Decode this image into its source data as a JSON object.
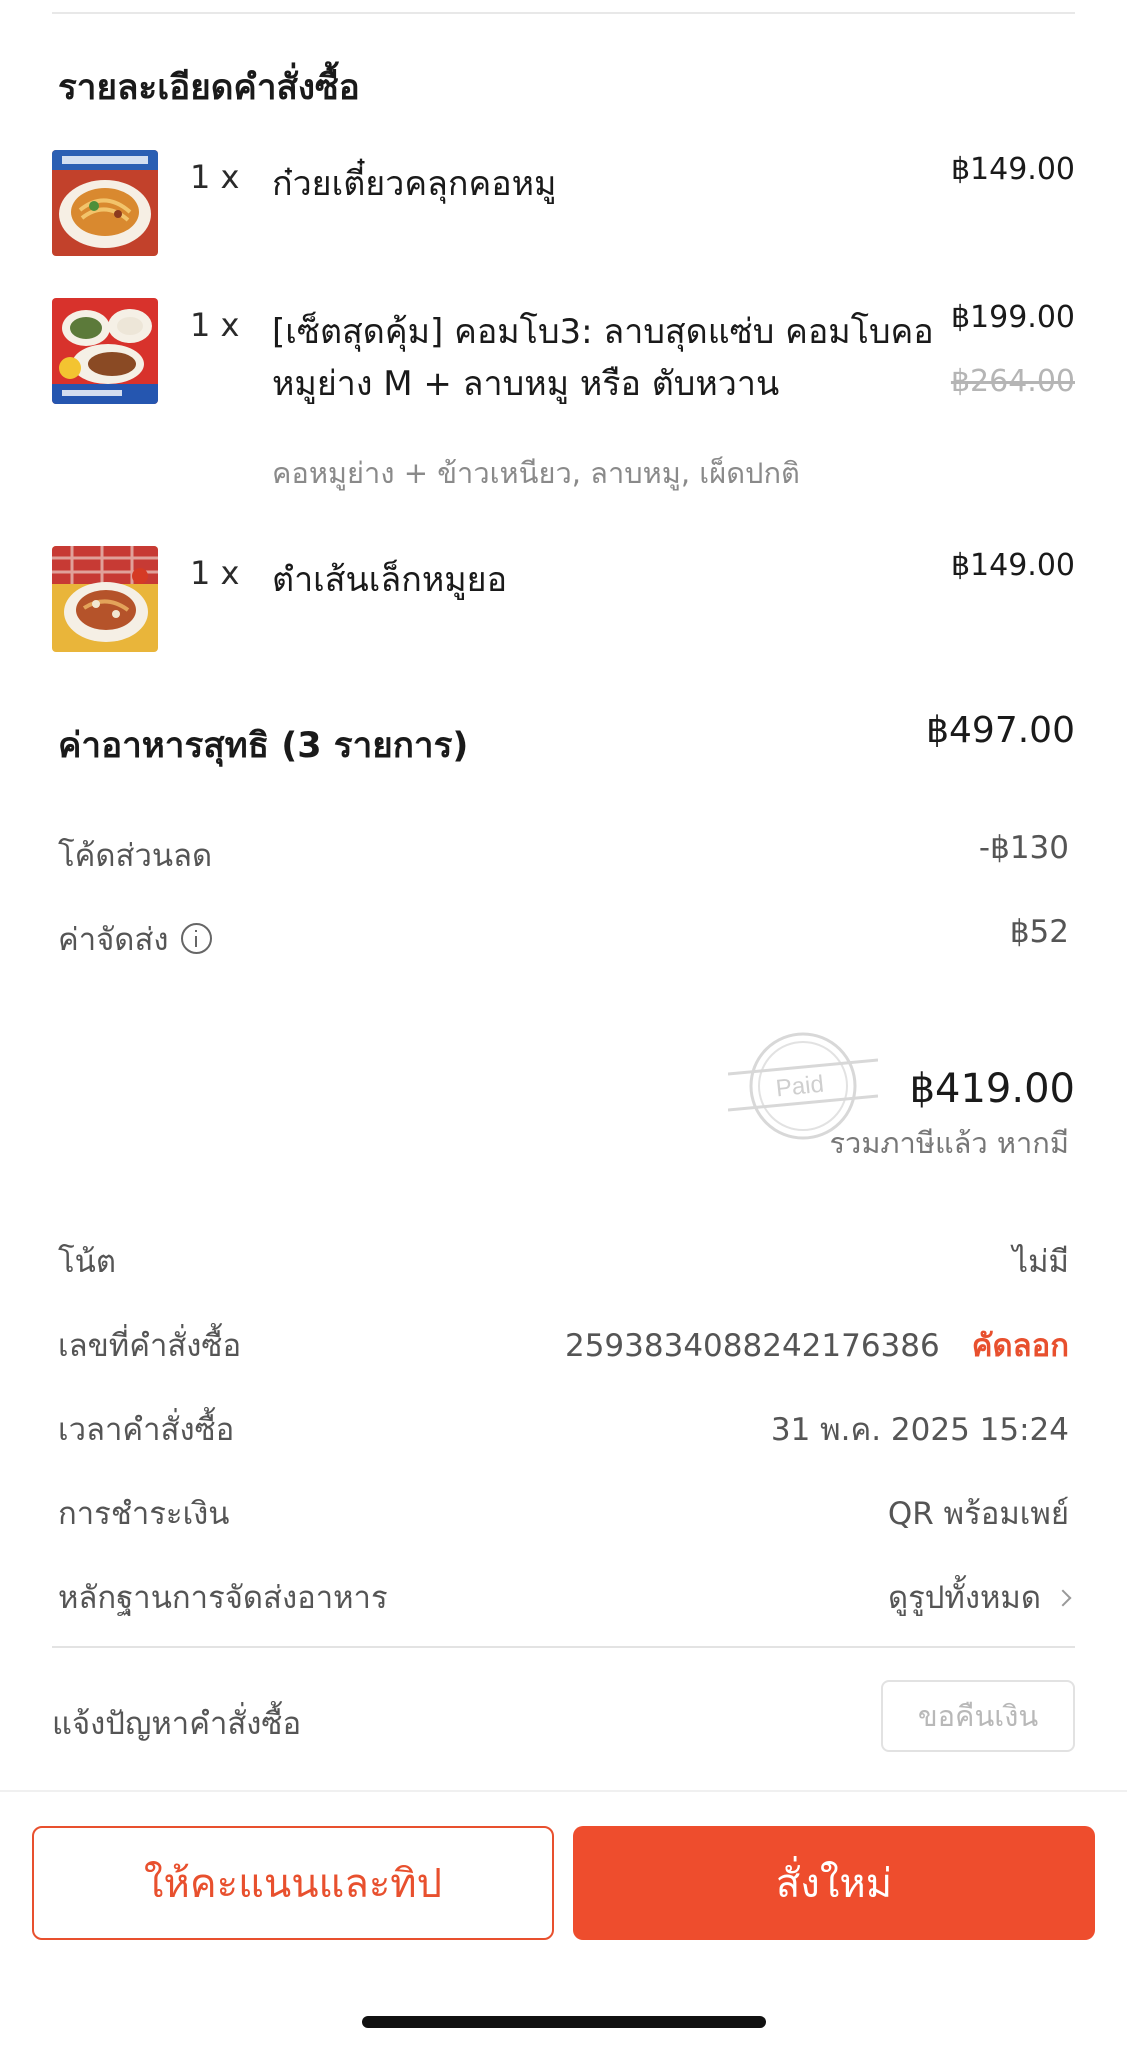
{
  "order_details": {
    "title": "รายละเอียดคำสั่งซื้อ",
    "items": [
      {
        "qty": "1 x",
        "name": "ก๋วยเตี๋ยวคลุกคอหมู",
        "price": "฿149.00",
        "old_price": "",
        "options": ""
      },
      {
        "qty": "1 x",
        "name": "[เซ็ตสุดคุ้ม] คอมโบ3: ลาบสุดแซ่บ คอมโบคอหมูย่าง M + ลาบหมู หรือ ตับหวาน",
        "price": "฿199.00",
        "old_price": "฿264.00",
        "options": "คอหมูย่าง + ข้าวเหนียว, ลาบหมู, เผ็ดปกติ"
      },
      {
        "qty": "1 x",
        "name": "ตำเส้นเล็กหมูยอ",
        "price": "฿149.00",
        "old_price": "",
        "options": ""
      }
    ]
  },
  "summary": {
    "subtotal_label": "ค่าอาหารสุทธิ (3 รายการ)",
    "subtotal_value": "฿497.00",
    "discount_label": "โค้ดส่วนลด",
    "discount_value": "-฿130",
    "delivery_label": "ค่าจัดส่ง",
    "delivery_value": "฿52",
    "paid_stamp": "Paid",
    "total_value": "฿419.00",
    "tax_note": "รวมภาษีแล้ว หากมี"
  },
  "info": {
    "note_label": "โน้ต",
    "note_value": "ไม่มี",
    "order_no_label": "เลขที่คำสั่งซื้อ",
    "order_no_value": "2593834088242176386",
    "copy_label": "คัดลอก",
    "order_time_label": "เวลาคำสั่งซื้อ",
    "order_time_value": "31 พ.ค. 2025 15:24",
    "payment_label": "การชำระเงิน",
    "payment_value": "QR พร้อมเพย์",
    "proof_label": "หลักฐานการจัดส่งอาหาร",
    "proof_value": "ดูรูปทั้งหมด"
  },
  "report": {
    "label": "แจ้งปัญหาคำสั่งซื้อ",
    "refund_button": "ขอคืนเงิน"
  },
  "actions": {
    "rate_button": "ให้คะแนนและทิป",
    "reorder_button": "สั่งใหม่"
  },
  "colors": {
    "accent": "#ee4d2d",
    "muted_text": "#555555",
    "strikethrough": "#b5b5b5"
  }
}
